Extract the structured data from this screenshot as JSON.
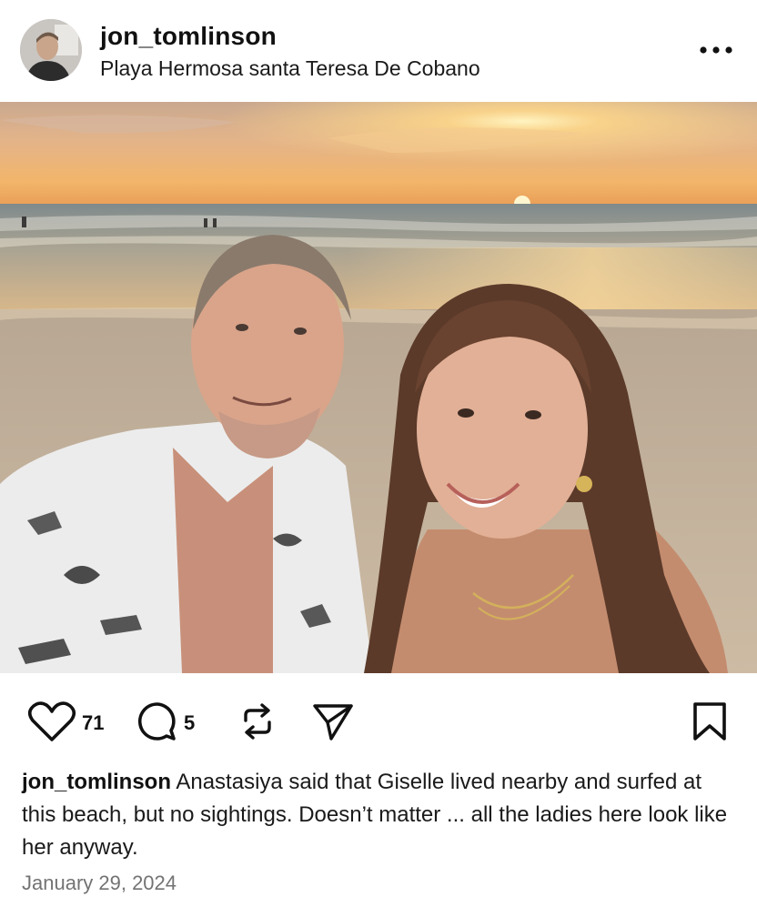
{
  "post": {
    "username": "jon_tomlinson",
    "location": "Playa Hermosa santa Teresa De Cobano",
    "likes": "71",
    "comments": "5",
    "caption_user": "jon_tomlinson",
    "caption_text": "Anastasiya said that Giselle lived nearby and surfed at this beach, but no sightings. Doesn’t matter ... all the ladies here look like her anyway.",
    "date": "January 29, 2024"
  },
  "icons": {
    "more": "more-options-icon",
    "like": "heart-icon",
    "comment": "comment-icon",
    "repost": "repost-icon",
    "share": "share-icon",
    "save": "bookmark-icon"
  },
  "colors": {
    "text": "#111111",
    "secondary_text": "#737373",
    "background": "#ffffff"
  }
}
